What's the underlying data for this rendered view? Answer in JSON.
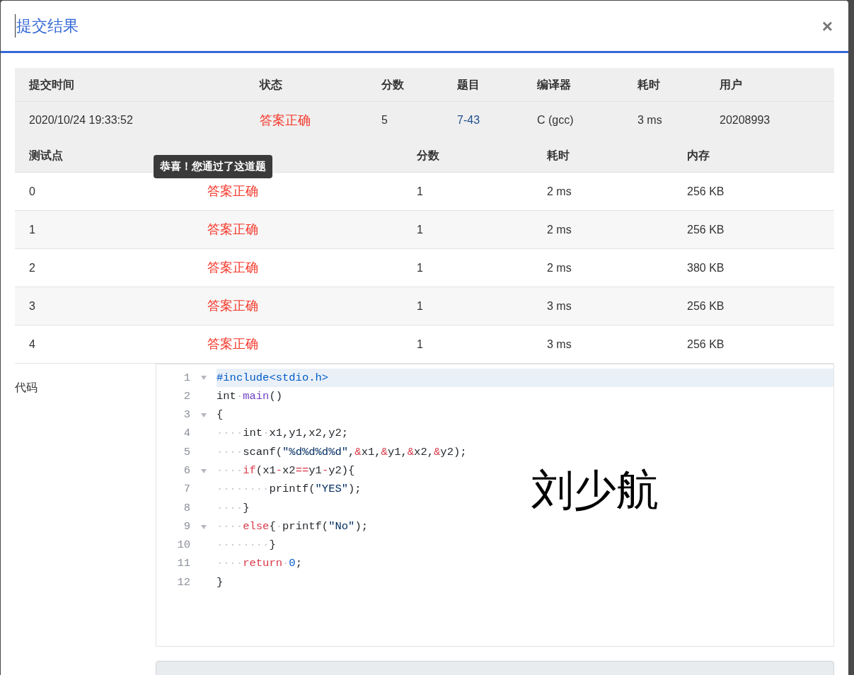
{
  "dialog": {
    "title": "提交结果",
    "close": "×"
  },
  "summary": {
    "columns": [
      "提交时间",
      "状态",
      "分数",
      "题目",
      "编译器",
      "耗时",
      "用户"
    ],
    "row": {
      "time": "2020/10/24 19:33:52",
      "status": "答案正确",
      "score": "5",
      "problem": "7-43",
      "compiler": "C (gcc)",
      "duration": "3 ms",
      "user": "20208993"
    }
  },
  "tests": {
    "columns": [
      "测试点",
      "分数",
      "耗时",
      "内存"
    ],
    "rows": [
      {
        "id": "0",
        "result": "答案正确",
        "score": "1",
        "duration": "2 ms",
        "memory": "256 KB"
      },
      {
        "id": "1",
        "result": "答案正确",
        "score": "1",
        "duration": "2 ms",
        "memory": "256 KB"
      },
      {
        "id": "2",
        "result": "答案正确",
        "score": "1",
        "duration": "2 ms",
        "memory": "380 KB"
      },
      {
        "id": "3",
        "result": "答案正确",
        "score": "1",
        "duration": "3 ms",
        "memory": "256 KB"
      },
      {
        "id": "4",
        "result": "答案正确",
        "score": "1",
        "duration": "3 ms",
        "memory": "256 KB"
      }
    ],
    "tooltip": "恭喜！您通过了这道题"
  },
  "code": {
    "label": "代码",
    "lines": [
      {
        "number": "1",
        "foldable": true,
        "active": true,
        "tokens": [
          {
            "kind": "meta",
            "text": "#include<stdio.h>"
          }
        ]
      },
      {
        "number": "2",
        "foldable": false,
        "active": false,
        "tokens": [
          {
            "kind": "plain",
            "text": "int"
          },
          {
            "kind": "ws",
            "text": "·"
          },
          {
            "kind": "func",
            "text": "main"
          },
          {
            "kind": "plain",
            "text": "()"
          }
        ]
      },
      {
        "number": "3",
        "foldable": true,
        "active": false,
        "tokens": [
          {
            "kind": "plain",
            "text": "{"
          }
        ]
      },
      {
        "number": "4",
        "foldable": false,
        "active": false,
        "tokens": [
          {
            "kind": "ws",
            "text": "····"
          },
          {
            "kind": "plain",
            "text": "int"
          },
          {
            "kind": "ws",
            "text": "·"
          },
          {
            "kind": "plain",
            "text": "x1,y1,x2,y2;"
          }
        ]
      },
      {
        "number": "5",
        "foldable": false,
        "active": false,
        "tokens": [
          {
            "kind": "ws",
            "text": "····"
          },
          {
            "kind": "plain",
            "text": "scanf("
          },
          {
            "kind": "string",
            "text": "\"%d%d%d%d\""
          },
          {
            "kind": "plain",
            "text": ","
          },
          {
            "kind": "op",
            "text": "&"
          },
          {
            "kind": "plain",
            "text": "x1,"
          },
          {
            "kind": "op",
            "text": "&"
          },
          {
            "kind": "plain",
            "text": "y1,"
          },
          {
            "kind": "op",
            "text": "&"
          },
          {
            "kind": "plain",
            "text": "x2,"
          },
          {
            "kind": "op",
            "text": "&"
          },
          {
            "kind": "plain",
            "text": "y2);"
          }
        ]
      },
      {
        "number": "6",
        "foldable": true,
        "active": false,
        "tokens": [
          {
            "kind": "ws",
            "text": "····"
          },
          {
            "kind": "op",
            "text": "if"
          },
          {
            "kind": "plain",
            "text": "(x1"
          },
          {
            "kind": "op",
            "text": "-"
          },
          {
            "kind": "plain",
            "text": "x2"
          },
          {
            "kind": "op",
            "text": "=="
          },
          {
            "kind": "plain",
            "text": "y1"
          },
          {
            "kind": "op",
            "text": "-"
          },
          {
            "kind": "plain",
            "text": "y2){"
          }
        ]
      },
      {
        "number": "7",
        "foldable": false,
        "active": false,
        "tokens": [
          {
            "kind": "ws",
            "text": "········"
          },
          {
            "kind": "plain",
            "text": "printf("
          },
          {
            "kind": "string",
            "text": "\"YES\""
          },
          {
            "kind": "plain",
            "text": ");"
          }
        ]
      },
      {
        "number": "8",
        "foldable": false,
        "active": false,
        "tokens": [
          {
            "kind": "ws",
            "text": "····"
          },
          {
            "kind": "plain",
            "text": "}"
          }
        ]
      },
      {
        "number": "9",
        "foldable": true,
        "active": false,
        "tokens": [
          {
            "kind": "ws",
            "text": "····"
          },
          {
            "kind": "op",
            "text": "else"
          },
          {
            "kind": "plain",
            "text": "{"
          },
          {
            "kind": "ws",
            "text": "·"
          },
          {
            "kind": "plain",
            "text": "printf("
          },
          {
            "kind": "string",
            "text": "\"No\""
          },
          {
            "kind": "plain",
            "text": ");"
          }
        ]
      },
      {
        "number": "10",
        "foldable": false,
        "active": false,
        "tokens": [
          {
            "kind": "ws",
            "text": "········"
          },
          {
            "kind": "plain",
            "text": "}"
          }
        ]
      },
      {
        "number": "11",
        "foldable": false,
        "active": false,
        "tokens": [
          {
            "kind": "ws",
            "text": "····"
          },
          {
            "kind": "op",
            "text": "return"
          },
          {
            "kind": "ws",
            "text": "·"
          },
          {
            "kind": "meta",
            "text": "0"
          },
          {
            "kind": "plain",
            "text": ";"
          }
        ]
      },
      {
        "number": "12",
        "foldable": false,
        "active": false,
        "tokens": [
          {
            "kind": "plain",
            "text": "}"
          }
        ]
      }
    ],
    "annotation": "刘少航"
  }
}
